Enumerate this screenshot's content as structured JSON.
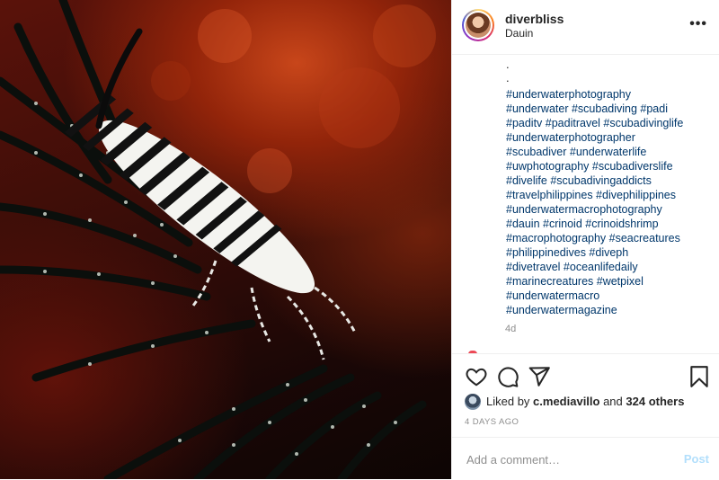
{
  "post": {
    "username": "diverbliss",
    "location": "Dauin",
    "more_label": "•••",
    "caption_dots": [
      ".",
      "."
    ],
    "hashtags": [
      "#underwaterphotography",
      "#underwater #scubadiving #padi",
      "#paditv #paditravel #scubadivinglife",
      "#underwaterphotographer",
      "#scubadiver #underwaterlife",
      "#uwphotography #scubadiverslife",
      "#divelife #scubadivingaddicts",
      "#travelphilippines #divephilippines",
      "#underwatermacrophotography",
      "#dauin #crinoid #crinoidshrimp",
      "#macrophotography #seacreatures",
      "#philippinedives #diveph",
      "#divetravel #oceanlifedaily",
      "#marinecreatures #wetpixel",
      "#underwatermacro",
      "#underwatermagazine"
    ],
    "caption_age": "4d",
    "liked_by_prefix": "Liked by ",
    "liked_by_user": "c.mediavillo",
    "liked_by_joiner": " and ",
    "liked_by_others": "324 others",
    "timestamp": "4 DAYS AGO"
  },
  "comment": {
    "placeholder": "Add a comment…",
    "post_label": "Post"
  },
  "icons": {
    "like": "heart-icon",
    "comment": "comment-icon",
    "share": "paper-plane-icon",
    "save": "bookmark-icon",
    "more": "more-dots-icon"
  },
  "colors": {
    "hashtag": "#00376b",
    "muted": "#8e8e8e",
    "post_button_disabled": "#b2dffc",
    "text": "#262626"
  }
}
